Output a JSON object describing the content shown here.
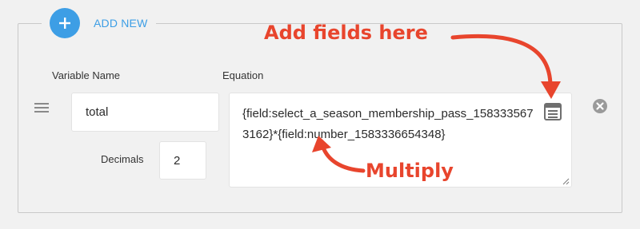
{
  "add_new": {
    "label": "ADD NEW",
    "icon": "plus-icon"
  },
  "columns": {
    "variable_name": "Variable Name",
    "equation": "Equation"
  },
  "row": {
    "variable_value": "total",
    "decimals_label": "Decimals",
    "decimals_value": "2",
    "equation_value": "{field:select_a_season_membership_pass_1583335673162}*{field:number_1583336654348}"
  },
  "icons": {
    "drag": "drag-handle-icon",
    "field_picker": "list-icon",
    "remove": "close-circle-icon"
  },
  "annotations": {
    "add_fields": "Add fields here",
    "multiply": "Multiply"
  },
  "colors": {
    "accent": "#3d9ee5",
    "annotation": "#e8452d",
    "background": "#f1f1f1"
  }
}
